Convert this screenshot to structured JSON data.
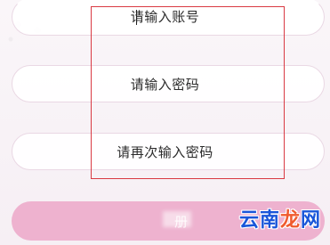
{
  "form": {
    "account_placeholder": "请输入账号",
    "password_placeholder": "请输入密码",
    "confirm_password_placeholder": "请再次输入密码"
  },
  "buttons": {
    "register_label": "册"
  },
  "watermark": {
    "text_part_1": "云南",
    "text_part_2": "龙",
    "text_part_3": "网"
  },
  "colors": {
    "highlight": "#d93a43",
    "button_background": "#eeb2cf",
    "watermark_blue": "#1a56d9",
    "watermark_orange": "#f05b2e"
  }
}
